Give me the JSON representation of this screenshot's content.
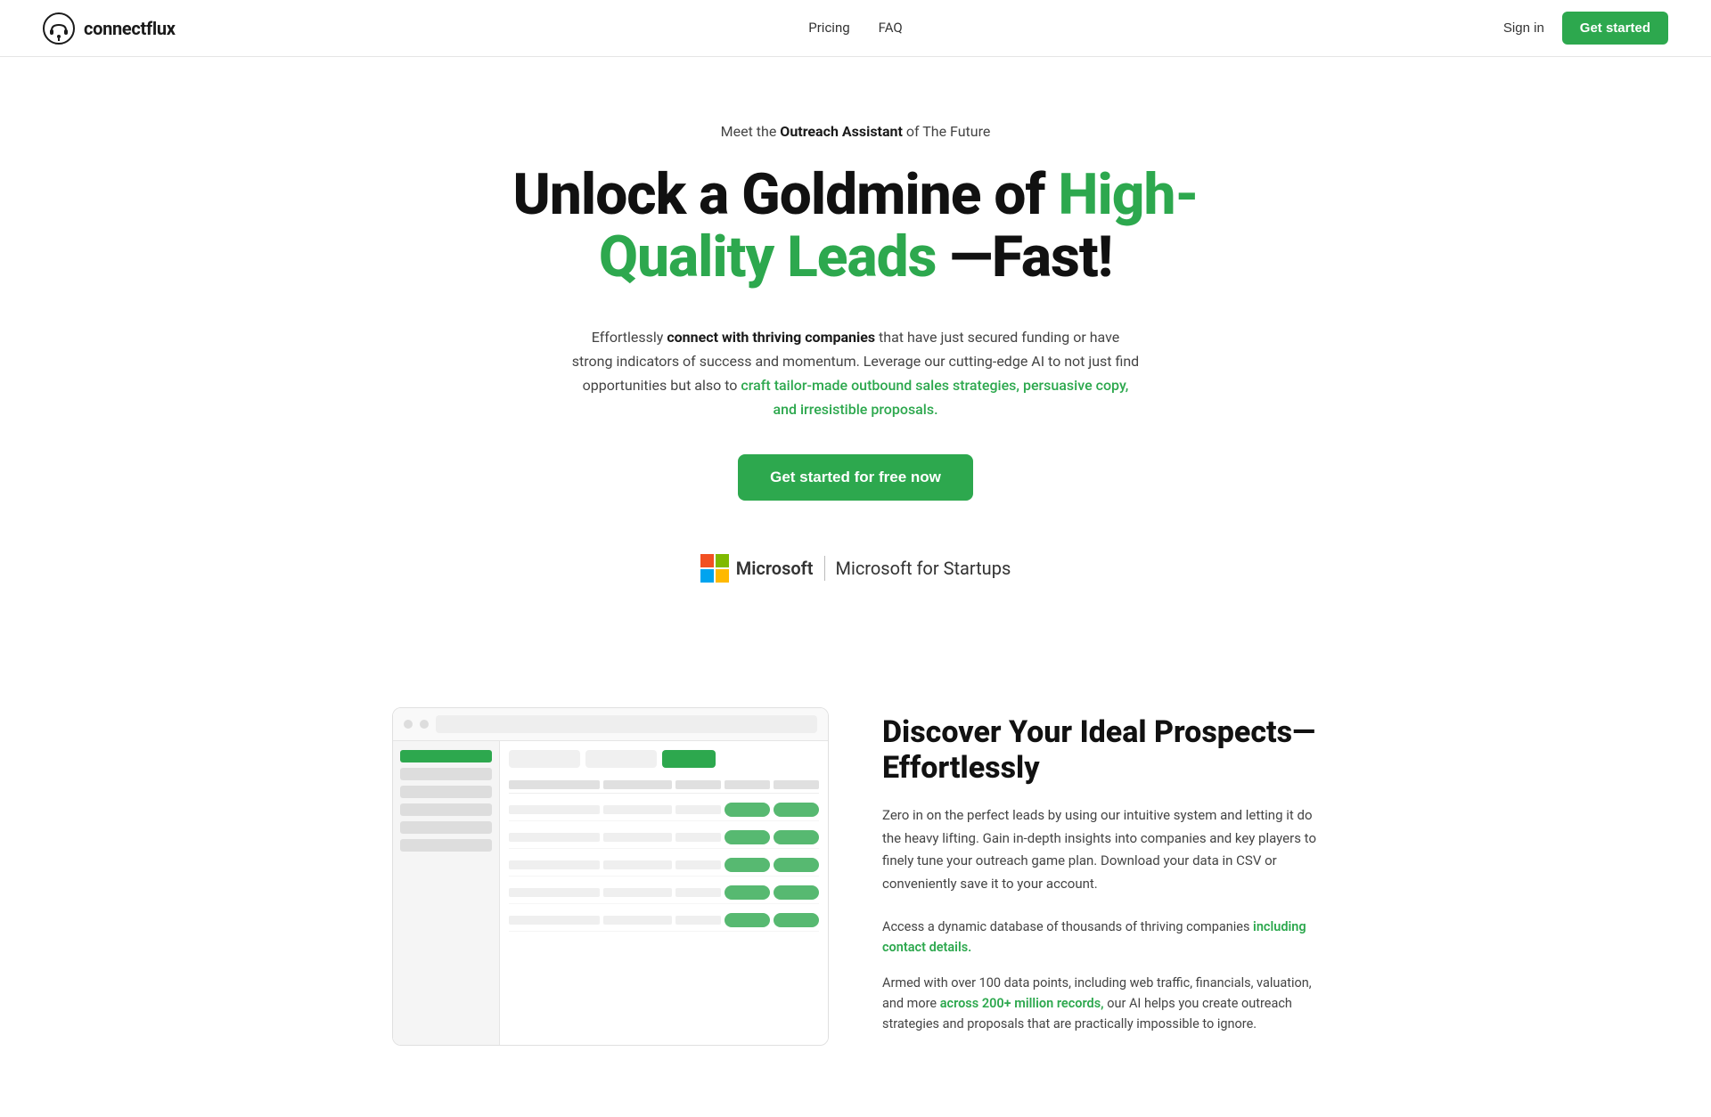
{
  "nav": {
    "logo_text": "connectflux",
    "links": [
      {
        "label": "Pricing",
        "id": "pricing"
      },
      {
        "label": "FAQ",
        "id": "faq"
      }
    ],
    "signin_label": "Sign in",
    "get_started_label": "Get started"
  },
  "hero": {
    "eyebrow_prefix": "Meet the ",
    "eyebrow_bold": "Outreach Assistant",
    "eyebrow_suffix": " of The Future",
    "headline_part1": "Unlock a Goldmine of ",
    "headline_green": "High-Quality Leads",
    "headline_part2": " —Fast!",
    "body_prefix": "Effortlessly ",
    "body_bold": "connect with thriving companies",
    "body_mid": " that have just secured funding or have strong indicators of success and momentum. Leverage our cutting-edge AI to not just find opportunities but also to ",
    "body_link": "craft tailor-made outbound sales strategies, persuasive copy, and irresistible proposals.",
    "cta_label": "Get started for free now"
  },
  "microsoft_badge": {
    "ms_name": "Microsoft",
    "divider": "|",
    "for_startups": "Microsoft for Startups"
  },
  "discover": {
    "title": "Discover Your Ideal Prospects—Effortlessly",
    "body": "Zero in on the perfect leads by using our intuitive system and letting it do the heavy lifting. Gain in-depth insights into companies and key players to finely tune your outreach game plan. Download your data in CSV or conveniently save it to your account.",
    "bullets": [
      {
        "text_prefix": "Access a dynamic database of thousands of thriving companies ",
        "text_link": "including contact details.",
        "text_suffix": ""
      },
      {
        "text_prefix": "Armed with over 100 data points, including web traffic, financials, valuation, and more ",
        "text_link": "across 200+ million records,",
        "text_suffix": " our AI helps you create outreach strategies and proposals that are practically impossible to ignore."
      }
    ]
  }
}
